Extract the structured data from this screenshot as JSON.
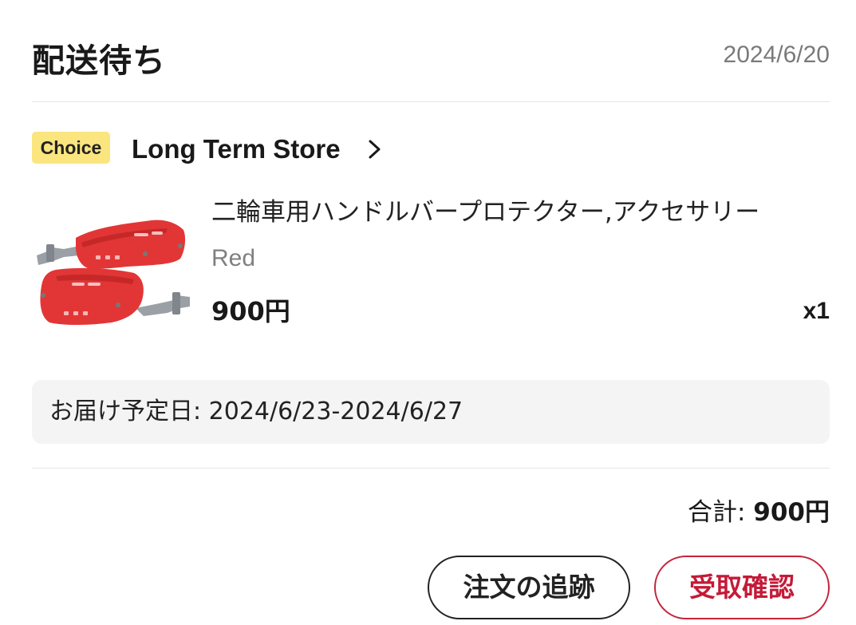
{
  "order": {
    "status": "配送待ち",
    "date": "2024/6/20"
  },
  "store": {
    "badge": "Choice",
    "name": "Long Term Store",
    "badge_color": "#fbe57f"
  },
  "product": {
    "title": "二輪車用ハンドルバープロテクター,アクセサリー",
    "variant": "Red",
    "price": "900円",
    "quantity": "x1",
    "image_icon": "red-motorcycle-handguard-image"
  },
  "delivery": {
    "text": "お届け予定日: 2024/6/23-2024/6/27"
  },
  "summary": {
    "total_label": "合計: ",
    "total_value": "900円"
  },
  "actions": {
    "track_label": "注文の追跡",
    "confirm_label": "受取確認",
    "confirm_color": "#c41a37"
  }
}
